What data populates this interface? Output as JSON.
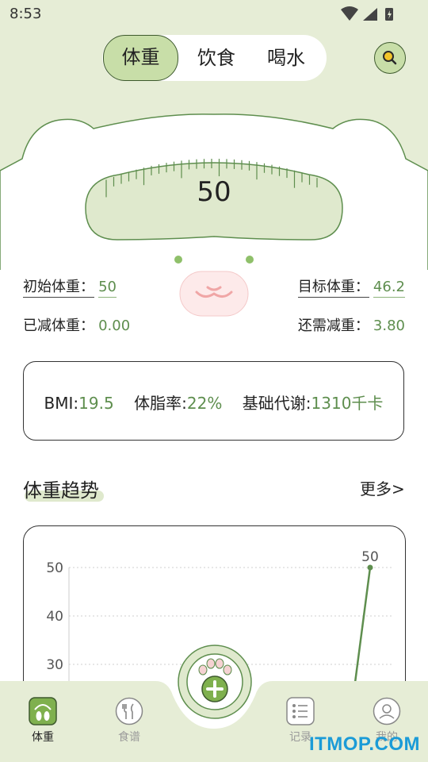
{
  "status_bar": {
    "time": "8:53"
  },
  "tabs": [
    {
      "label": "体重",
      "active": true
    },
    {
      "label": "饮食",
      "active": false
    },
    {
      "label": "喝水",
      "active": false
    }
  ],
  "search": {
    "icon": "search-icon"
  },
  "scale": {
    "weight": "50"
  },
  "stats": {
    "initial_label": "初始体重：",
    "initial_value": "50",
    "target_label": "目标体重：",
    "target_value": "46.2",
    "lost_label": "已减体重：",
    "lost_value": "0.00",
    "remaining_label": "还需减重：",
    "remaining_value": "3.80"
  },
  "bmi_card": {
    "bmi_label": "BMI:",
    "bmi_value": "19.5",
    "fat_label": "体脂率:",
    "fat_value": "22%",
    "bmr_label": "基础代谢:",
    "bmr_value": "1310千卡"
  },
  "trend": {
    "title": "体重趋势",
    "more": "更多>"
  },
  "chart_data": {
    "type": "line",
    "y_ticks": [
      "50",
      "40",
      "30"
    ],
    "ylim": [
      20,
      50
    ],
    "grid": true,
    "series": [
      {
        "values": [
          20,
          50
        ],
        "data_labels": [
          "",
          "50"
        ]
      }
    ],
    "color": "#5e8e4e"
  },
  "nav": [
    {
      "label": "体重",
      "icon": "scale-icon",
      "active": true
    },
    {
      "label": "食谱",
      "icon": "fork-knife-icon",
      "active": false
    },
    {
      "label": "",
      "icon": "paw-add-icon",
      "active": false
    },
    {
      "label": "记录",
      "icon": "list-icon",
      "active": false
    },
    {
      "label": "我的",
      "icon": "user-icon",
      "active": false
    }
  ],
  "watermark": "ITMOP.COM",
  "colors": {
    "accent": "#c8dea8",
    "bg_green": "#e6edd6",
    "value_green": "#5e8e4e"
  }
}
